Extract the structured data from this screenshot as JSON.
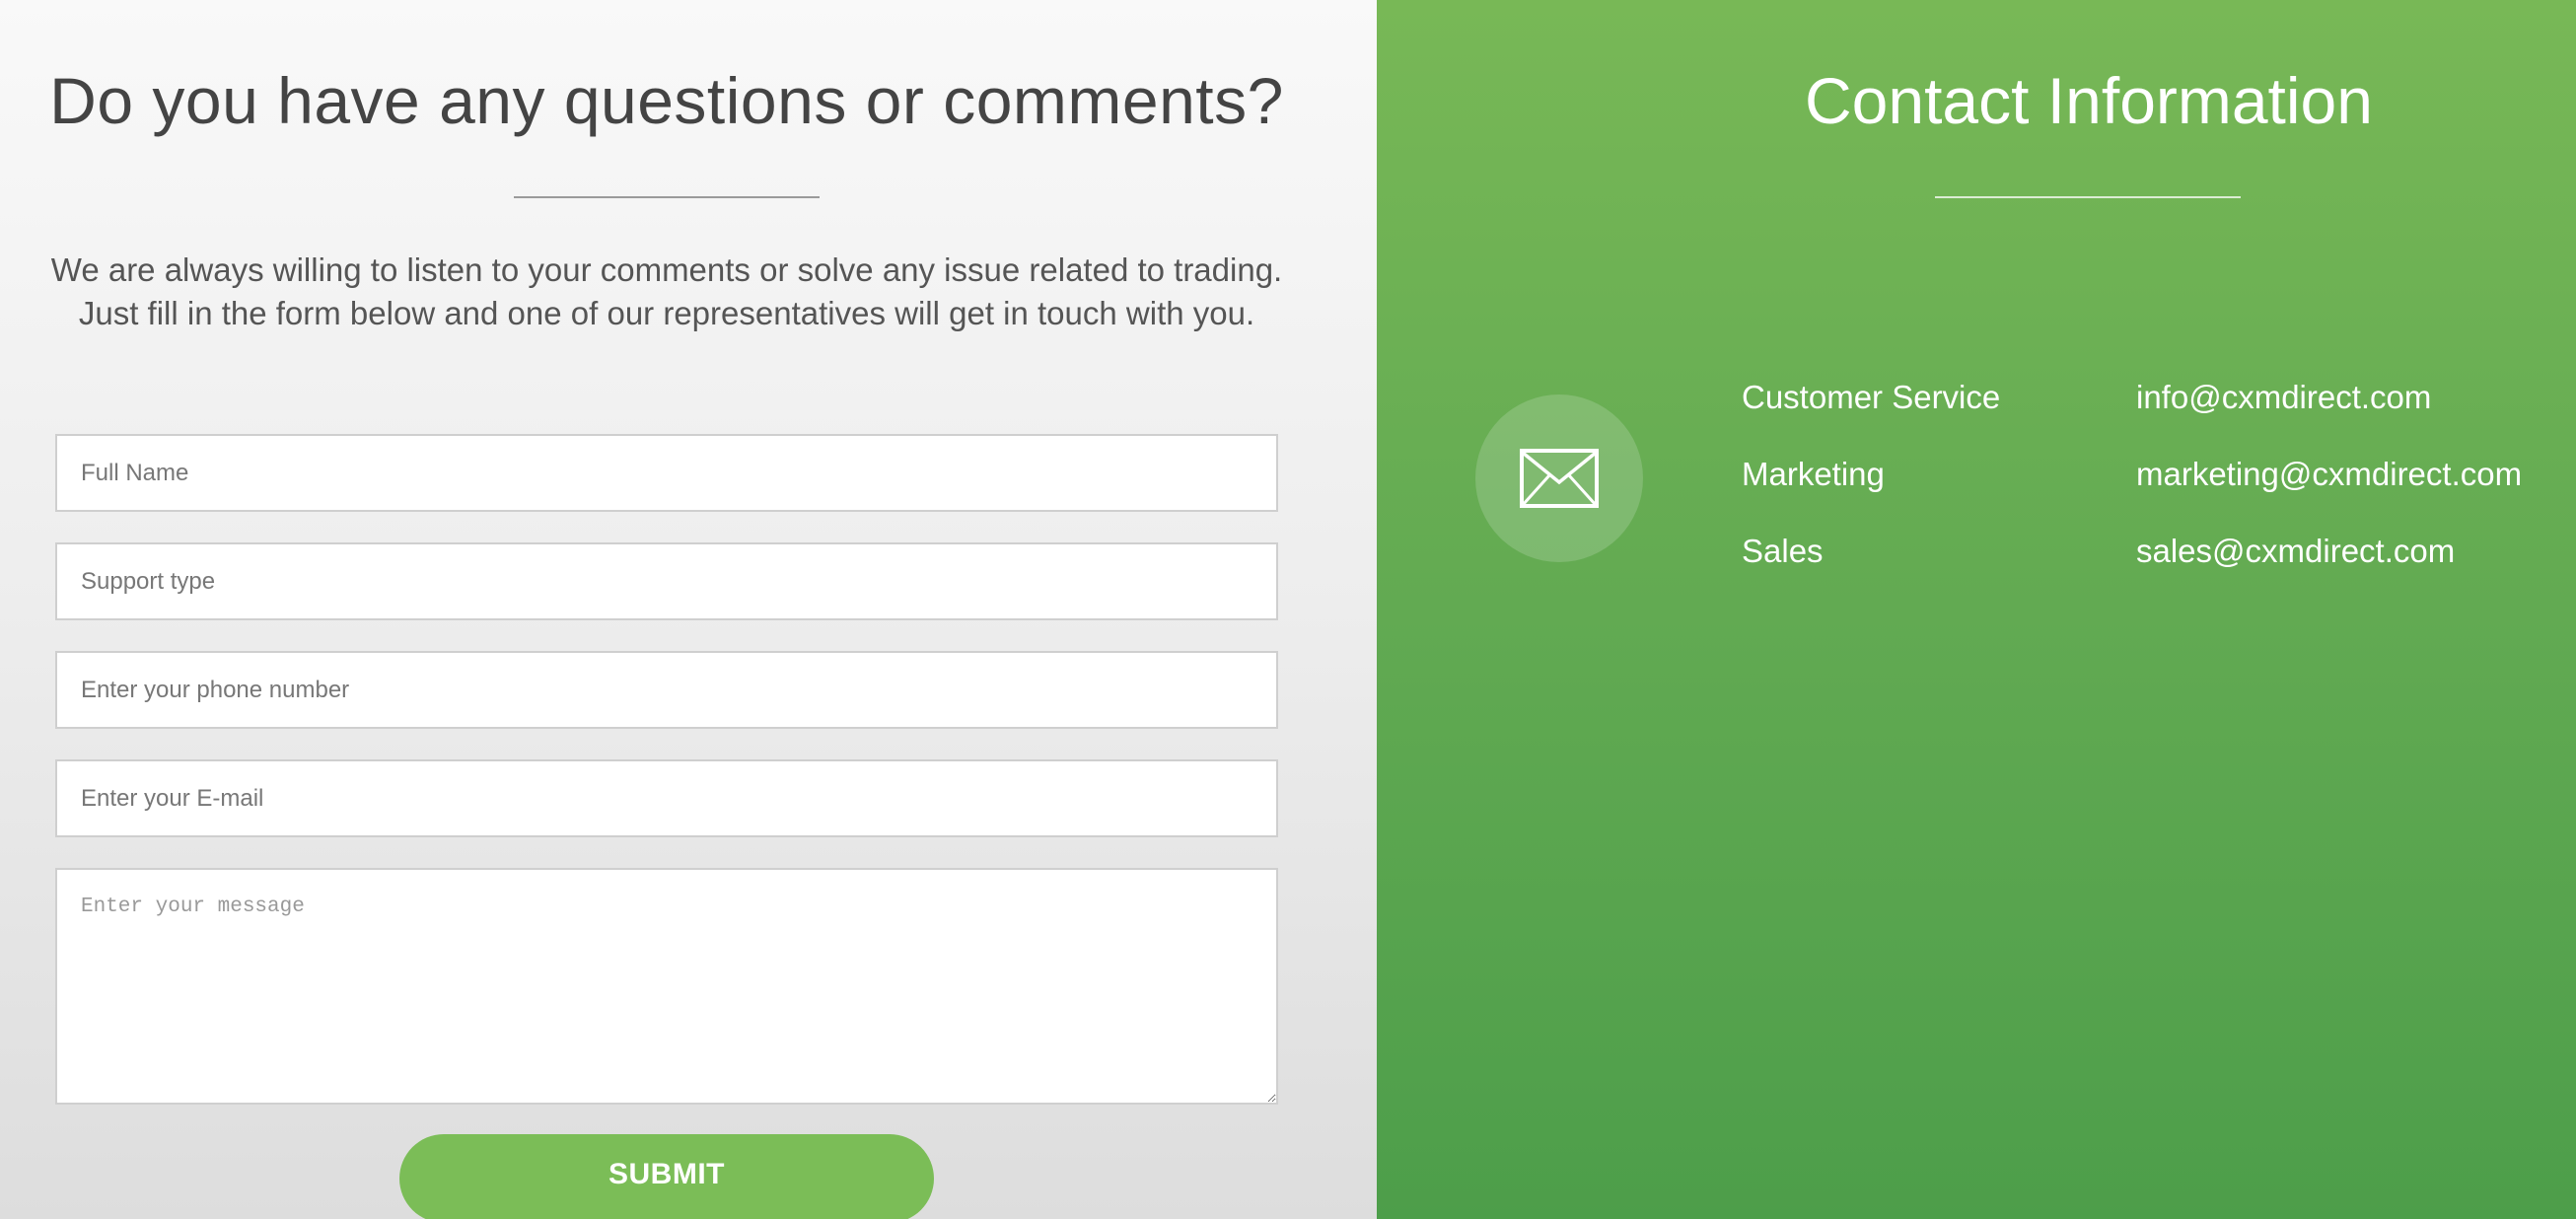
{
  "questions_section": {
    "title": "Do you have any questions or comments?",
    "intro_line1": "We are always willing to listen to your comments or solve any issue related to trading.",
    "intro_line2": "Just fill in the form below and one of our representatives will get in touch with you."
  },
  "form": {
    "full_name": {
      "placeholder": "Full Name",
      "value": ""
    },
    "support_type": {
      "placeholder": "Support type",
      "value": ""
    },
    "phone": {
      "placeholder": "Enter your phone number",
      "value": ""
    },
    "email": {
      "placeholder": "Enter your E-mail",
      "value": ""
    },
    "message": {
      "placeholder": "Enter your message",
      "value": ""
    },
    "submit_label": "SUBMIT"
  },
  "contact_section": {
    "title": "Contact Information",
    "icon": "envelope-icon",
    "contacts": [
      {
        "label": "Customer Service",
        "email": "info@cxmdirect.com"
      },
      {
        "label": "Marketing",
        "email": "marketing@cxmdirect.com"
      },
      {
        "label": "Sales",
        "email": "sales@cxmdirect.com"
      }
    ]
  },
  "colors": {
    "accent_green": "#7bbd57",
    "panel_green_top": "#78b856",
    "panel_green_bottom": "#4d9e4a",
    "text_dark": "#444444"
  }
}
